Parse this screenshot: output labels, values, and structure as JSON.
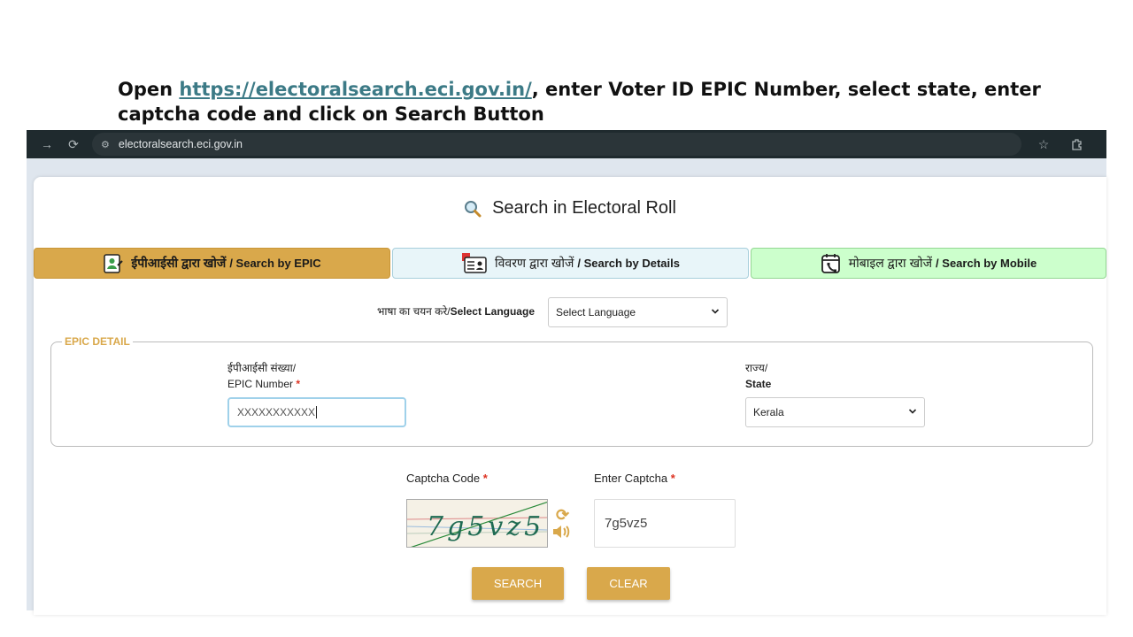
{
  "instruction": {
    "prefix": "Open ",
    "link": "https://electoralsearch.eci.gov.in/",
    "suffix": ", enter Voter ID EPIC Number, select state, enter captcha code and click on Search Button"
  },
  "browser": {
    "url": "electoralsearch.eci.gov.in"
  },
  "page": {
    "title": "Search in Electoral Roll",
    "tabs": [
      {
        "hindi": "ईपीआईसी द्वारा खोजें",
        "english": "/ Search by EPIC",
        "icon": "id-card-icon"
      },
      {
        "hindi": "विवरण द्वारा खोजें",
        "english": "/ Search by Details",
        "icon": "details-card-icon"
      },
      {
        "hindi": "मोबाइल द्वारा खोजें",
        "english": "/ Search by Mobile",
        "icon": "mobile-calendar-icon"
      }
    ],
    "language": {
      "label_hindi": "भाषा का चयन करे/",
      "label_english": "Select Language",
      "selected": "Select Language"
    },
    "epic_detail": {
      "legend": "EPIC DETAIL",
      "epic_label_hindi": "ईपीआईसी संख्या/",
      "epic_label_english": "EPIC Number",
      "required_mark": "*",
      "epic_value": "XXXXXXXXXXX",
      "state_label_hindi": "राज्य/",
      "state_label_english": "State",
      "state_selected": "Kerala"
    },
    "captcha": {
      "label": "Captcha Code",
      "enter_label": "Enter Captcha",
      "required_mark": "*",
      "image_text": "7g5vz5",
      "entered_value": "7g5vz5"
    },
    "buttons": {
      "search": "SEARCH",
      "clear": "CLEAR"
    }
  },
  "colors": {
    "accent": "#d9a84b",
    "link": "#3c7a86",
    "tab_details_bg": "#e8f5f9",
    "tab_mobile_bg": "#ccffcc",
    "browser_bar": "#1f2a2e"
  }
}
